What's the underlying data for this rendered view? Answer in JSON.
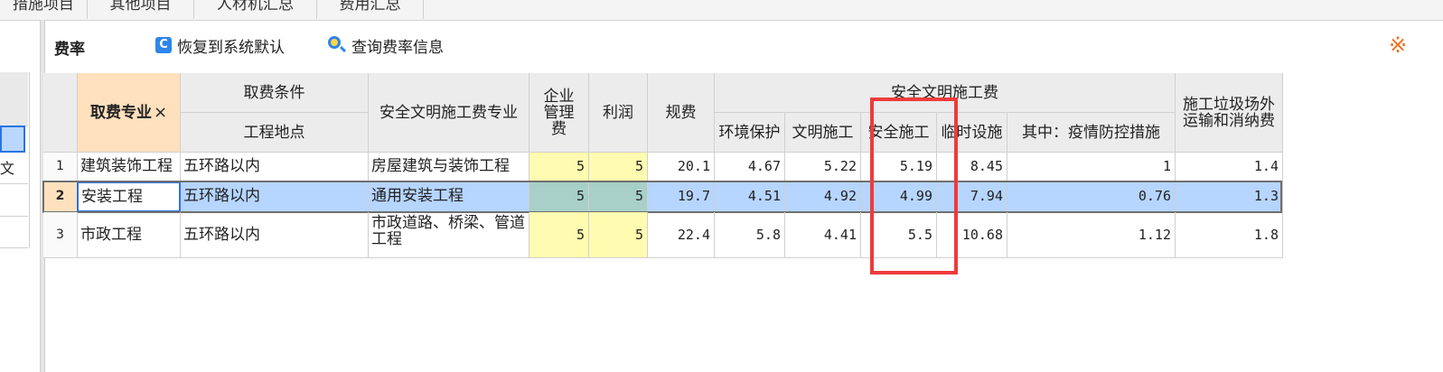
{
  "tabs": [
    "措施项目",
    "其他项目",
    "人材机汇总",
    "费用汇总"
  ],
  "left_pane": {
    "partial_text": "文"
  },
  "toolbar": {
    "title": "费率",
    "restore_label": "恢复到系统默认",
    "query_label": "查询费率信息",
    "corner_symbol": "※"
  },
  "table": {
    "headers": {
      "specialty": "取费专业",
      "close": "×",
      "condition": "取费条件",
      "location": "工程地点",
      "safety_specialty": "安全文明施工费专业",
      "mgmt_fee": "企业管理费",
      "profit": "利润",
      "regulation_fee": "规费",
      "safety_group": "安全文明施工费",
      "env": "环境保护",
      "civil": "文明施工",
      "safety": "安全施工",
      "temp": "临时设施",
      "epidemic": "其中：疫情防控措施",
      "waste": "施工垃圾场外运输和消纳费"
    },
    "rows": [
      {
        "no": "1",
        "specialty": "建筑装饰工程",
        "location": "五环路以内",
        "safety_specialty": "房屋建筑与装饰工程",
        "mgmt_fee": "5",
        "profit": "5",
        "regulation_fee": "20.1",
        "env": "4.67",
        "civil": "5.22",
        "safety": "5.19",
        "temp": "8.45",
        "epidemic": "1",
        "waste": "1.4"
      },
      {
        "no": "2",
        "specialty": "安装工程",
        "location": "五环路以内",
        "safety_specialty": "通用安装工程",
        "mgmt_fee": "5",
        "profit": "5",
        "regulation_fee": "19.7",
        "env": "4.51",
        "civil": "4.92",
        "safety": "4.99",
        "temp": "7.94",
        "epidemic": "0.76",
        "waste": "1.3"
      },
      {
        "no": "3",
        "specialty": "市政工程",
        "location": "五环路以内",
        "safety_specialty": "市政道路、桥梁、管道工程",
        "mgmt_fee": "5",
        "profit": "5",
        "regulation_fee": "22.4",
        "env": "5.8",
        "civil": "4.41",
        "safety": "5.5",
        "temp": "10.68",
        "epidemic": "1.12",
        "waste": "1.8"
      }
    ]
  },
  "colors": {
    "accent": "#2b74e0",
    "highlight_border": "#ee3b3b",
    "selected_row": "#b6d5ff",
    "editable_cell": "#fffbb0",
    "header_active": "#ffe1be"
  }
}
